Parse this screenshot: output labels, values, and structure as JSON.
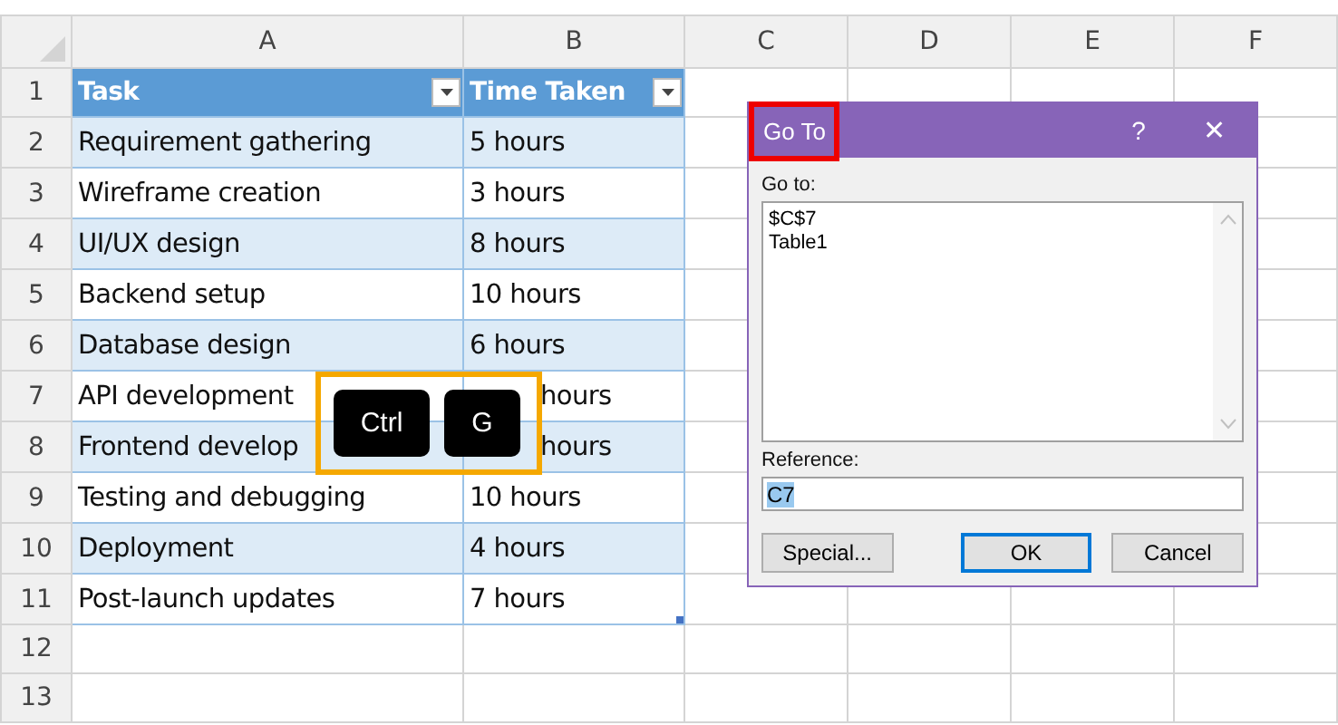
{
  "sheet": {
    "columns": [
      "A",
      "B",
      "C",
      "D",
      "E",
      "F"
    ],
    "rows": [
      {
        "num": "1",
        "kind": "header",
        "cells": [
          "Task",
          "Time Taken"
        ]
      },
      {
        "num": "2",
        "kind": "band",
        "cells": [
          "Requirement gathering",
          "5 hours"
        ]
      },
      {
        "num": "3",
        "kind": "plain",
        "cells": [
          "Wireframe creation",
          "3 hours"
        ]
      },
      {
        "num": "4",
        "kind": "band",
        "cells": [
          "UI/UX design",
          "8 hours"
        ]
      },
      {
        "num": "5",
        "kind": "plain",
        "cells": [
          "Backend setup",
          "10 hours"
        ]
      },
      {
        "num": "6",
        "kind": "band",
        "cells": [
          "Database design",
          "6 hours"
        ]
      },
      {
        "num": "7",
        "kind": "plain",
        "cells": [
          "API development",
          "hours"
        ]
      },
      {
        "num": "8",
        "kind": "band",
        "cells": [
          "Frontend develop",
          "hours"
        ]
      },
      {
        "num": "9",
        "kind": "plain",
        "cells": [
          "Testing and debugging",
          "10 hours"
        ]
      },
      {
        "num": "10",
        "kind": "band",
        "cells": [
          "Deployment",
          "4 hours"
        ]
      },
      {
        "num": "11",
        "kind": "plain",
        "cells": [
          "Post-launch updates",
          "7 hours"
        ]
      },
      {
        "num": "12",
        "kind": "empty",
        "cells": []
      },
      {
        "num": "13",
        "kind": "empty",
        "cells": []
      }
    ]
  },
  "shortcut": {
    "keys": [
      "Ctrl",
      "G"
    ]
  },
  "dialog": {
    "title": "Go To",
    "help": "?",
    "close": "✕",
    "goto_label": "Go to:",
    "list": [
      "$C$7",
      "Table1"
    ],
    "reference_label": "Reference:",
    "reference_value": "C7",
    "buttons": [
      {
        "label": "Special...",
        "default": false
      },
      {
        "label": "OK",
        "default": true
      },
      {
        "label": "Cancel",
        "default": false
      }
    ]
  }
}
